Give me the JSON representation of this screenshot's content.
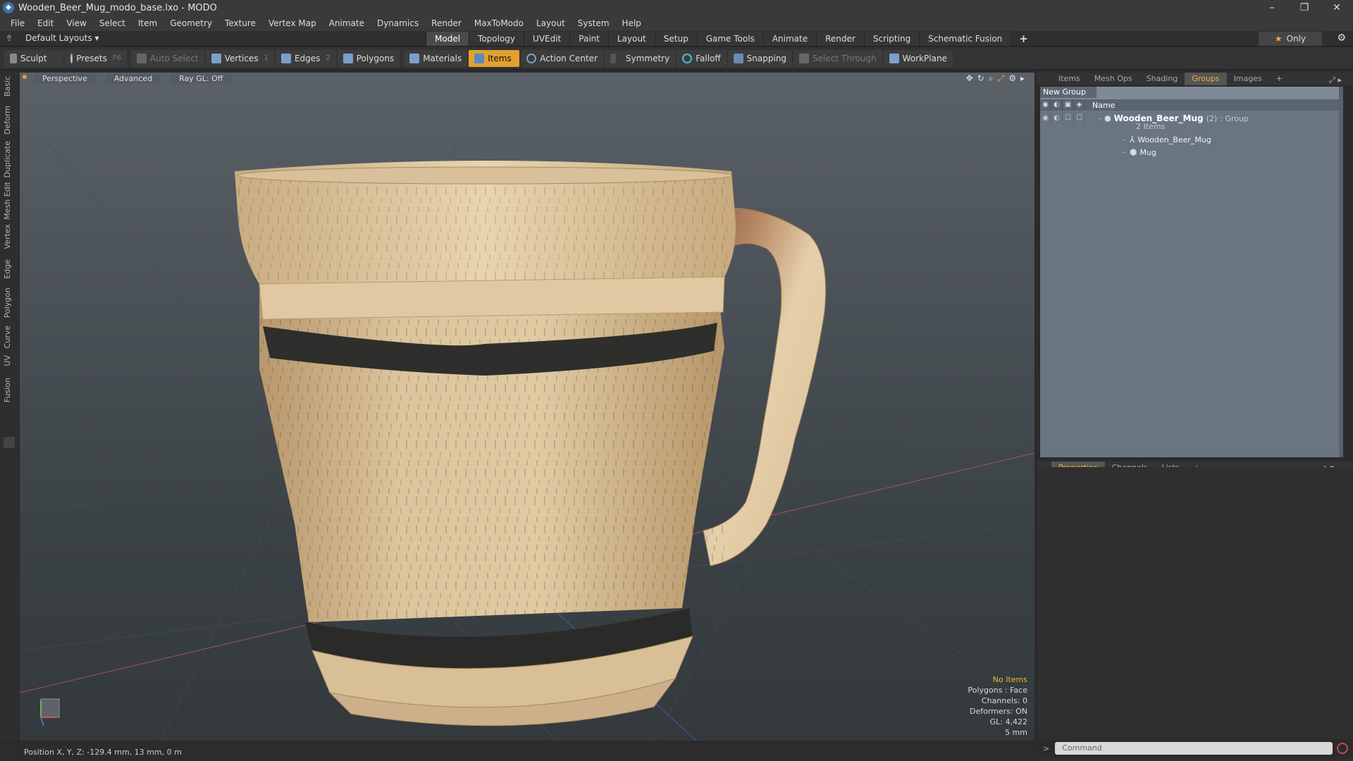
{
  "titlebar": {
    "title": "Wooden_Beer_Mug_modo_base.lxo - MODO",
    "minimize": "–",
    "restore": "❐",
    "close": "✕"
  },
  "menu": [
    "File",
    "Edit",
    "View",
    "Select",
    "Item",
    "Geometry",
    "Texture",
    "Vertex Map",
    "Animate",
    "Dynamics",
    "Render",
    "MaxToModo",
    "Layout",
    "System",
    "Help"
  ],
  "layoutbar": {
    "layout_label": "Default Layouts ▾",
    "tabs": [
      "Model",
      "Topology",
      "UVEdit",
      "Paint",
      "Layout",
      "Setup",
      "Game Tools",
      "Animate",
      "Render",
      "Scripting",
      "Schematic Fusion"
    ],
    "active_tab": "Model",
    "only_label": "Only",
    "plus": "+"
  },
  "toolbar": {
    "sculpt": "Sculpt",
    "presets": "Presets",
    "presets_key": "F6",
    "auto_select": "Auto Select",
    "vertices": "Vertices",
    "vertices_key": "1",
    "edges": "Edges",
    "edges_key": "2",
    "polygons": "Polygons",
    "materials": "Materials",
    "items": "Items",
    "action_center": "Action Center",
    "symmetry": "Symmetry",
    "falloff": "Falloff",
    "snapping": "Snapping",
    "select_through": "Select Through",
    "workplane": "WorkPlane"
  },
  "left_tabs": [
    "Basic",
    "Deform",
    "Duplicate",
    "Mesh Edit",
    "Vertex",
    "Edge",
    "Polygon",
    "Curve",
    "UV",
    "Fusion"
  ],
  "viewport": {
    "view_mode": "Perspective",
    "shading": "Advanced",
    "raygl": "Ray GL: Off",
    "stats": {
      "no_items": "No Items",
      "polygons": "Polygons : Face",
      "channels": "Channels: 0",
      "deformers": "Deformers: ON",
      "gl": "GL: 4,422",
      "grid": "5 mm"
    }
  },
  "statusbar": {
    "position": "Position X, Y, Z:  -129.4 mm, 13 mm, 0 m"
  },
  "right_panel": {
    "top_tabs": [
      "Items",
      "Mesh Ops",
      "Shading",
      "Groups",
      "Images"
    ],
    "active_top_tab": "Groups",
    "new_group": "New Group",
    "column_name": "Name",
    "groups": {
      "group_name": "Wooden_Beer_Mug",
      "group_count": "(2)",
      "group_type": ": Group",
      "items_count": "2 Items",
      "children": [
        "Wooden_Beer_Mug",
        "Mug"
      ]
    },
    "bottom_tabs": [
      "Properties",
      "Channels",
      "Lists"
    ],
    "active_bottom_tab": "Properties",
    "command_placeholder": "Command"
  },
  "colors": {
    "accent": "#e3a02f",
    "groups_bg": "#6a7582",
    "viewport_top": "#5a6167"
  }
}
